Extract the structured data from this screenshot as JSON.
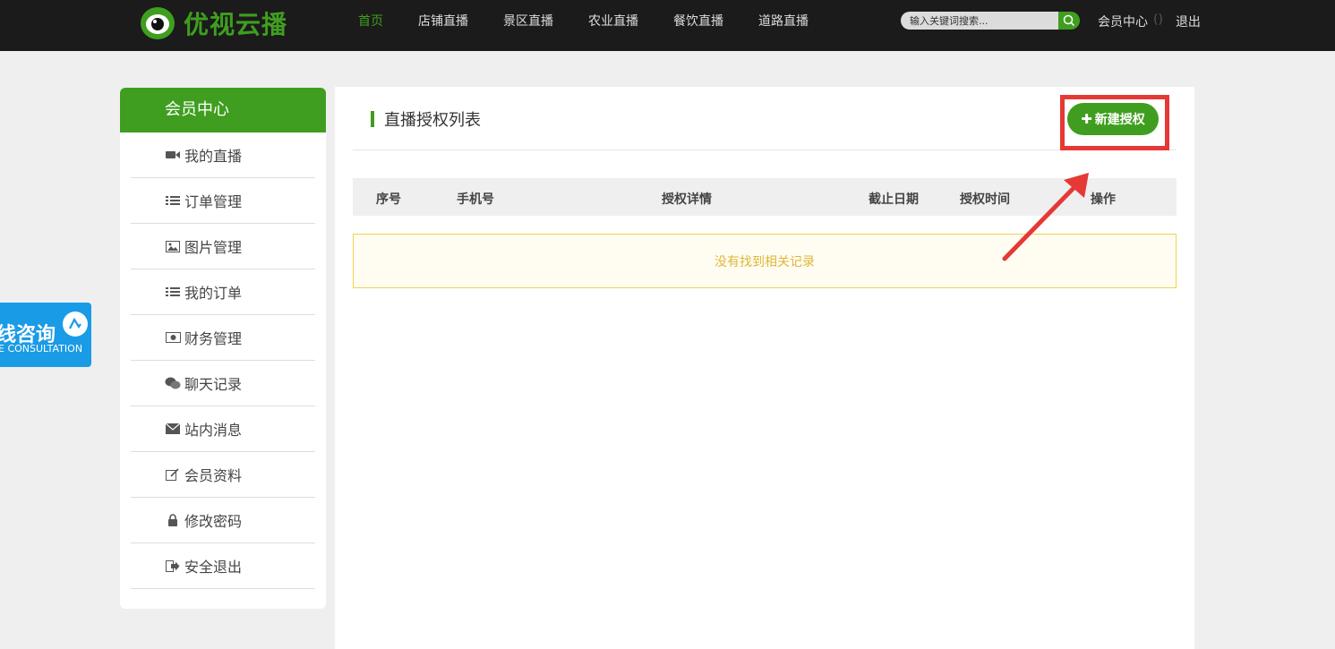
{
  "header": {
    "logo_text": "优视云播",
    "nav": [
      {
        "label": "首页",
        "active": true
      },
      {
        "label": "店铺直播",
        "active": false
      },
      {
        "label": "景区直播",
        "active": false
      },
      {
        "label": "农业直播",
        "active": false
      },
      {
        "label": "餐饮直播",
        "active": false
      },
      {
        "label": "道路直播",
        "active": false
      }
    ],
    "search": {
      "placeholder": "输入关键词搜索..."
    },
    "member_center": "会员中心",
    "member_count": "()",
    "logout": "退出"
  },
  "sidebar": {
    "title": "会员中心",
    "items": [
      {
        "label": "我的直播",
        "icon": "video-camera-icon"
      },
      {
        "label": "订单管理",
        "icon": "list-icon"
      },
      {
        "label": "图片管理",
        "icon": "image-icon"
      },
      {
        "label": "我的订单",
        "icon": "list-icon"
      },
      {
        "label": "财务管理",
        "icon": "money-icon"
      },
      {
        "label": "聊天记录",
        "icon": "wechat-icon"
      },
      {
        "label": "站内消息",
        "icon": "envelope-icon"
      },
      {
        "label": "会员资料",
        "icon": "edit-icon"
      },
      {
        "label": "修改密码",
        "icon": "lock-icon"
      },
      {
        "label": "安全退出",
        "icon": "sign-out-icon"
      }
    ]
  },
  "main": {
    "title": "直播授权列表",
    "new_button": "新建授权",
    "table": {
      "headers": [
        "序号",
        "手机号",
        "授权详情",
        "截止日期",
        "授权时间",
        "操作"
      ],
      "empty_text": "没有找到相关记录"
    }
  },
  "consult": {
    "title": "线咨询",
    "subtitle": "E CONSULTATION"
  },
  "colors": {
    "brand_green": "#3f9e1f",
    "topbar": "#1b1b1b",
    "highlight_red": "#e53935",
    "consult_blue": "#1a9be6"
  }
}
